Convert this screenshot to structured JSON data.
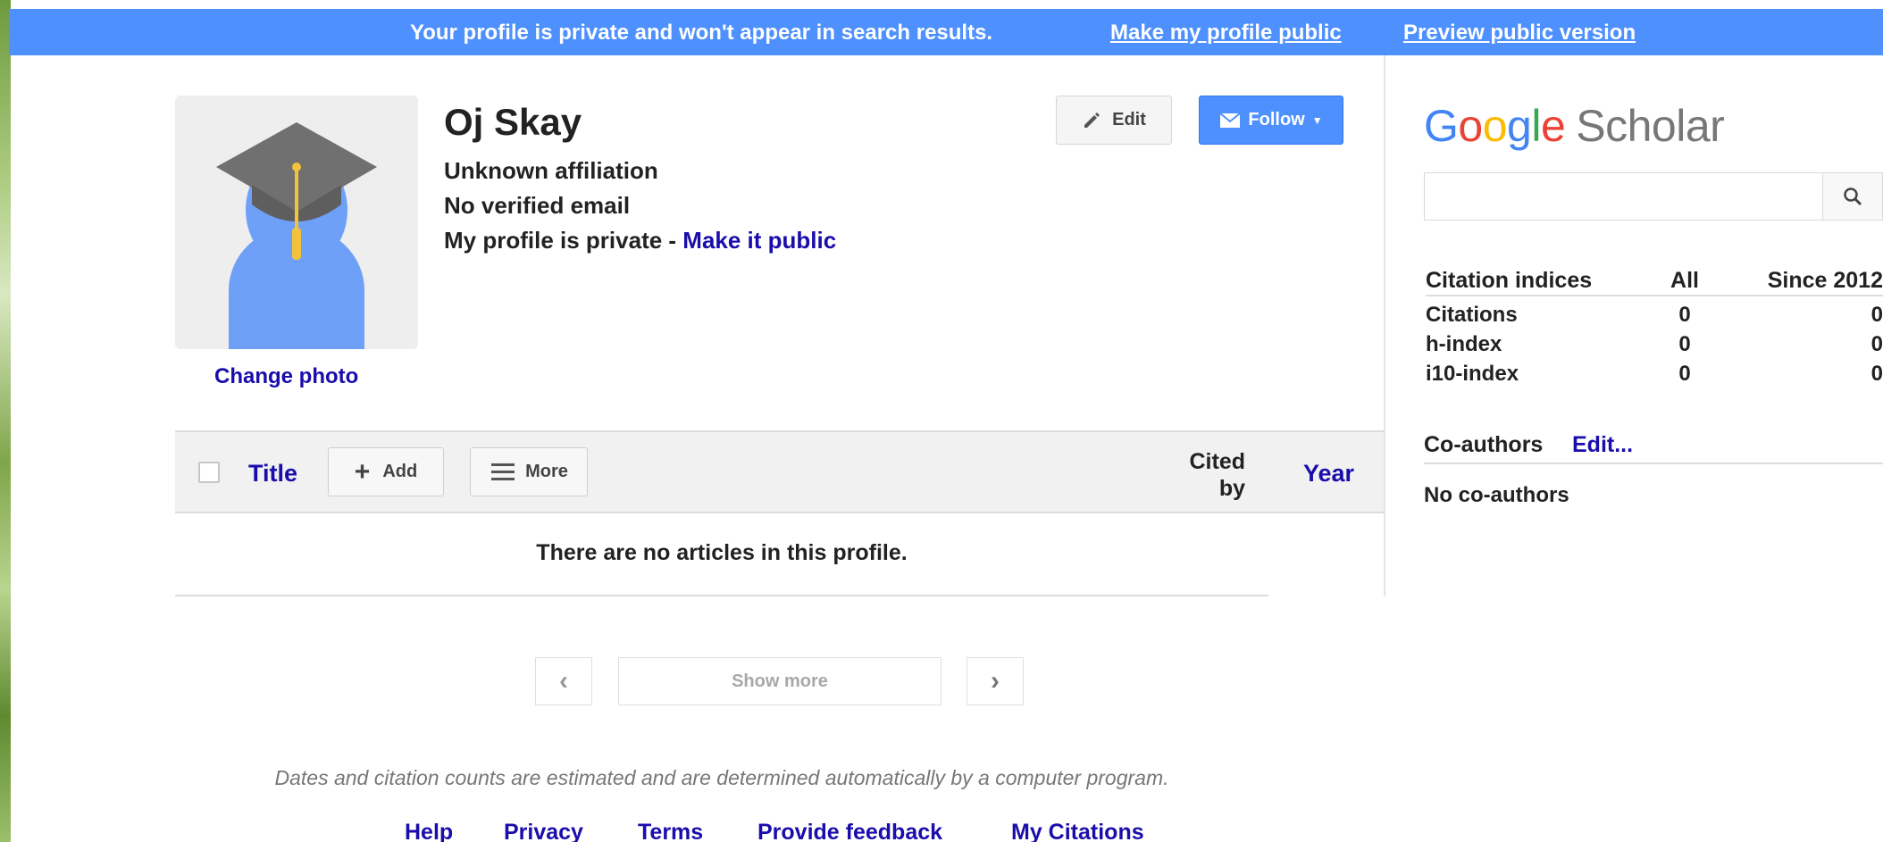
{
  "banner": {
    "message": "Your profile is private and won't appear in search results.",
    "make_public_link": "Make my profile public",
    "preview_link": "Preview public version"
  },
  "profile": {
    "name": "Oj Skay",
    "affiliation": "Unknown affiliation",
    "email_status": "No verified email",
    "privacy_text": "My profile is private - ",
    "make_public_link": "Make it public",
    "change_photo": "Change photo",
    "avatar_icon": "scholar-avatar-icon"
  },
  "actions": {
    "edit_label": "Edit",
    "follow_label": "Follow"
  },
  "articles": {
    "columns": {
      "title": "Title",
      "cited_by_line1": "Cited",
      "cited_by_line2": "by",
      "year": "Year"
    },
    "add_label": "Add",
    "more_label": "More",
    "empty_message": "There are no articles in this profile.",
    "show_more": "Show more",
    "prev_glyph": "‹",
    "next_glyph": "›"
  },
  "disclaimer": "Dates and citation counts are estimated and are determined automatically by a computer program.",
  "footer": {
    "links": [
      "Help",
      "Privacy",
      "Terms",
      "Provide feedback",
      "My Citations"
    ]
  },
  "sidebar": {
    "logo_google": "Google",
    "logo_scholar": "Scholar",
    "search_value": "",
    "citations": {
      "headers": [
        "Citation indices",
        "All",
        "Since 2012"
      ],
      "rows": [
        [
          "Citations",
          "0",
          "0"
        ],
        [
          "h-index",
          "0",
          "0"
        ],
        [
          "i10-index",
          "0",
          "0"
        ]
      ]
    },
    "coauthors_title": "Co-authors",
    "coauthors_edit": "Edit...",
    "no_coauthors": "No co-authors"
  },
  "colors": {
    "accent_blue": "#4d90fe",
    "link_blue": "#1a0dab"
  }
}
